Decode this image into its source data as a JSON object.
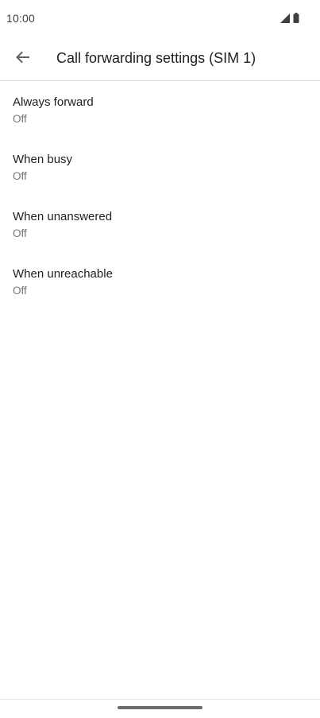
{
  "status_bar": {
    "time": "10:00",
    "icons": [
      "cell-signal-icon",
      "battery-icon"
    ]
  },
  "app_bar": {
    "back_icon": "arrow-back-icon",
    "title": "Call forwarding settings (SIM 1)"
  },
  "settings": {
    "items": [
      {
        "title": "Always forward",
        "summary": "Off"
      },
      {
        "title": "When busy",
        "summary": "Off"
      },
      {
        "title": "When unanswered",
        "summary": "Off"
      },
      {
        "title": "When unreachable",
        "summary": "Off"
      }
    ]
  },
  "colors": {
    "primary_text": "#202124",
    "secondary_text": "#70757a",
    "divider": "#e0e0e0"
  }
}
